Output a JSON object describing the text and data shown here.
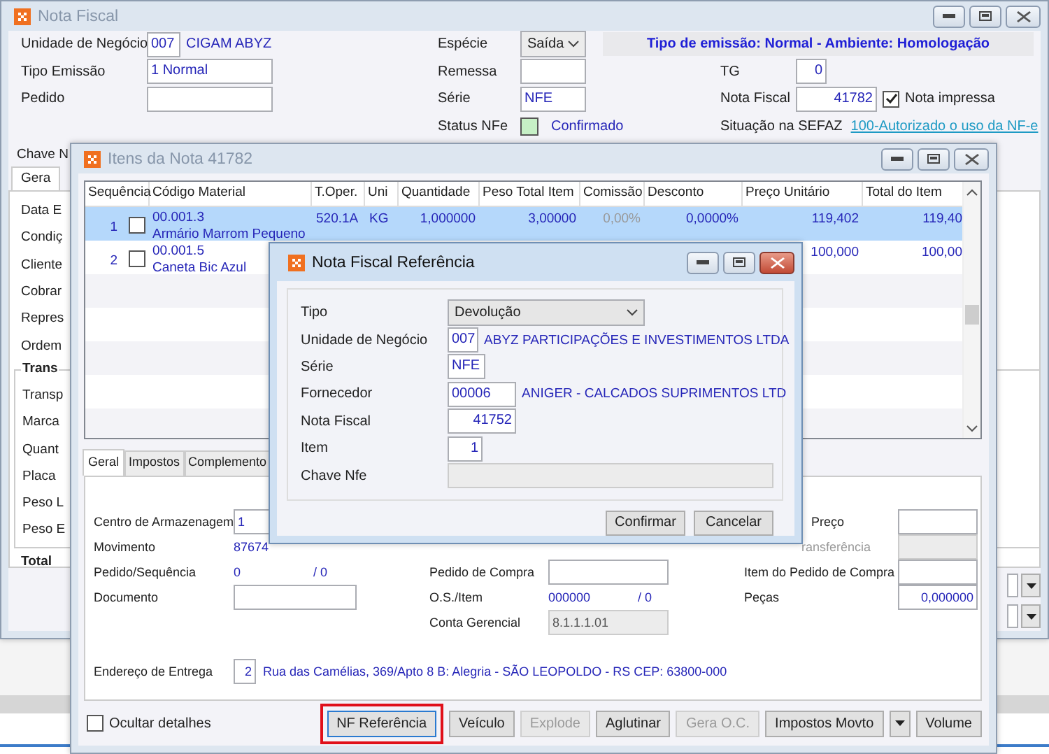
{
  "main_window": {
    "title": "Nota Fiscal",
    "active": false,
    "unidade": {
      "label": "Unidade de Negócio",
      "code": "007",
      "name": "CIGAM ABYZ"
    },
    "especie": {
      "label": "Espécie",
      "value": "Saída"
    },
    "emission_banner": "Tipo de emissão: Normal - Ambiente: Homologação",
    "tipo_emissao": {
      "label": "Tipo Emissão",
      "value": "1 Normal"
    },
    "remessa": {
      "label": "Remessa"
    },
    "tg": {
      "label": "TG",
      "value": "0"
    },
    "pedido": {
      "label": "Pedido"
    },
    "serie": {
      "label": "Série",
      "value": "NFE"
    },
    "nota_fiscal": {
      "label": "Nota Fiscal",
      "value": "41782"
    },
    "nota_impressa": {
      "label": "Nota impressa",
      "checked": true
    },
    "status_nfe": {
      "label": "Status NFe",
      "value": "Confirmado"
    },
    "situacao_sefaz": {
      "label": "Situação na SEFAZ",
      "link": "100-Autorizado o uso da NF-e"
    },
    "chave_label": "Chave N",
    "tabs": [
      {
        "label": "Gera",
        "selected": true
      }
    ],
    "labels": [
      "Data E",
      "Condiç",
      "Cliente",
      "Cobrar",
      "Repres",
      "Ordem"
    ],
    "group": {
      "title": "Trans",
      "labels": [
        "Transp",
        "Marca",
        "Quant",
        "Placa",
        "Peso L",
        "Peso E"
      ]
    },
    "total_label": "Total"
  },
  "items_window": {
    "title": "Itens da Nota 41782",
    "active": false,
    "columns": [
      "Sequência",
      "Código Material",
      "T.Oper.",
      "Uni",
      "Quantidade",
      "Peso Total Item",
      "Comissão",
      "Desconto",
      "Preço Unitário",
      "Total do Item"
    ],
    "rows": [
      {
        "seq": "1",
        "checked": false,
        "code": "00.001.3",
        "description": "Armário Marrom Pequeno",
        "t_oper": "520.1A",
        "uni": "KG",
        "quantidade": "1,000000",
        "peso_total": "3,00000",
        "comissao": "0,00%",
        "desconto": "0,0000%",
        "preco_unitario": "119,402",
        "total": "119,40",
        "selected": true
      },
      {
        "seq": "2",
        "checked": false,
        "code": "00.001.5",
        "description": "Caneta Bic Azul",
        "preco_unitario": "100,000",
        "total": "100,00",
        "selected": false
      }
    ],
    "tabs": [
      {
        "label": "Geral",
        "selected": true
      },
      {
        "label": "Impostos",
        "selected": false
      },
      {
        "label": "Complemento",
        "selected": false
      }
    ],
    "geral": {
      "centro": {
        "label": "Centro de Armazenagem",
        "value": "1"
      },
      "preco": {
        "label": "Preço"
      },
      "movimento": {
        "label": "Movimento",
        "value": "87674"
      },
      "transferencia": {
        "label": "ransferência",
        "disabled": true
      },
      "pedido_sequencia": {
        "label": "Pedido/Sequência",
        "value": "0",
        "sequence": "/ 0"
      },
      "pedido_compra": {
        "label": "Pedido de Compra"
      },
      "item_pedido_compra": {
        "label": "Item do Pedido de Compra"
      },
      "documento": {
        "label": "Documento"
      },
      "os_item": {
        "label": "O.S./Item",
        "value": "000000",
        "item": "/ 0"
      },
      "pecas": {
        "label": "Peças",
        "value": "0,000000"
      },
      "conta_gerencial": {
        "label": "Conta Gerencial",
        "value": "8.1.1.1.01",
        "disabled": true
      },
      "endereco": {
        "label": "Endereço de Entrega",
        "code": "2",
        "address": "Rua das Camélias, 369/Apto 8 B: Alegria - SÃO LEOPOLDO - RS CEP: 63800-000"
      }
    },
    "ocultar_detalhes": {
      "label": "Ocultar detalhes",
      "checked": false
    },
    "buttons": [
      {
        "kind": "button",
        "label": "NF Referência",
        "disabled": false,
        "highlighted": true
      },
      {
        "kind": "button",
        "label": "Veículo",
        "disabled": false,
        "highlighted": false
      },
      {
        "kind": "button",
        "label": "Explode",
        "disabled": true,
        "highlighted": false
      },
      {
        "kind": "button",
        "label": "Aglutinar",
        "disabled": false,
        "highlighted": false
      },
      {
        "kind": "button",
        "label": "Gera O.C.",
        "disabled": true,
        "highlighted": false
      },
      {
        "kind": "button",
        "label": "Impostos Movto",
        "disabled": false,
        "highlighted": false
      },
      {
        "kind": "menu"
      },
      {
        "kind": "button",
        "label": "Volume",
        "disabled": false,
        "highlighted": false
      }
    ]
  },
  "reference_dialog": {
    "title": "Nota Fiscal Referência",
    "active": true,
    "tipo": {
      "label": "Tipo",
      "value": "Devolução"
    },
    "unidade": {
      "label": "Unidade de Negócio",
      "code": "007",
      "name": "ABYZ PARTICIPAÇÕES E INVESTIMENTOS LTDA"
    },
    "serie": {
      "label": "Série",
      "value": "NFE"
    },
    "fornecedor": {
      "label": "Fornecedor",
      "code": "00006",
      "name": "ANIGER - CALCADOS SUPRIMENTOS LTD"
    },
    "nota_fiscal": {
      "label": "Nota Fiscal",
      "value": "41752"
    },
    "item": {
      "label": "Item",
      "value": "1"
    },
    "chave": {
      "label": "Chave Nfe",
      "disabled": true
    },
    "buttons": [
      "Confirmar",
      "Cancelar"
    ]
  }
}
